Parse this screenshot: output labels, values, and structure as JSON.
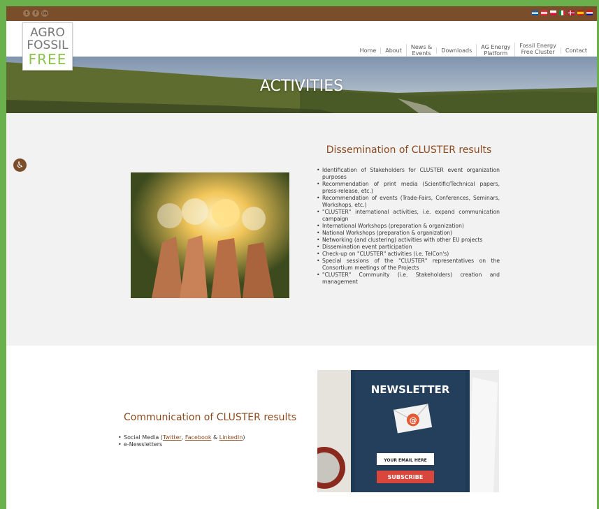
{
  "social": [
    "t",
    "f",
    "in"
  ],
  "header": {
    "logo": {
      "line1": "AGRO",
      "line2": "FOSSIL",
      "line3": "FREE"
    },
    "nav": [
      {
        "line1": "Home",
        "line2": ""
      },
      {
        "line1": "About",
        "line2": ""
      },
      {
        "line1": "News &",
        "line2": "Events"
      },
      {
        "line1": "Downloads",
        "line2": ""
      },
      {
        "line1": "AG Energy",
        "line2": "Platform"
      },
      {
        "line1": "Fossil Energy",
        "line2": "Free Cluster"
      },
      {
        "line1": "Contact",
        "line2": ""
      }
    ]
  },
  "banner": {
    "title": "ACTIVITIES"
  },
  "section1": {
    "title": "Dissemination of CLUSTER results",
    "items": [
      "Identification of Stakeholders for CLUSTER event organization purposes",
      "Recommendation of print media (Scientific/Technical papers, press-release, etc.)",
      "Recommendation of events (Trade-Fairs, Conferences, Seminars, Workshops, etc.)",
      "\"CLUSTER\" international activities, i.e. expand communication campaign",
      "International Workshops (preparation & organization)",
      "National Workshops (preparation & organization)",
      "Networking (and clustering) activities with other EU projects",
      "Dissemination event participation",
      "Check-up on \"CLUSTER\" activities (i.e. TelCon's)",
      "Special sessions of the \"CLUSTER\" representatives on the Consortium meetings of the Projects",
      "\"CLUSTER\" Community (i.e. Stakeholders) creation and management"
    ]
  },
  "section2": {
    "title": "Communication of CLUSTER results",
    "social_prefix": "Social Media (",
    "twitter": "Twitter",
    "sep1": ", ",
    "facebook": "Facebook",
    "sep2": " & ",
    "linkedin": "LinkedIn",
    "social_suffix": ")",
    "item2": "e-Newsletters"
  },
  "newsletter": {
    "heading": "NEWSLETTER",
    "field": "YOUR EMAIL HERE",
    "button": "SUBSCRIBE"
  },
  "colors": {
    "topbar": "#7a4e2a",
    "accent_green": "#8bc34a",
    "heading_brown": "#8b4a1f",
    "frame_green": "#6ab04c"
  }
}
